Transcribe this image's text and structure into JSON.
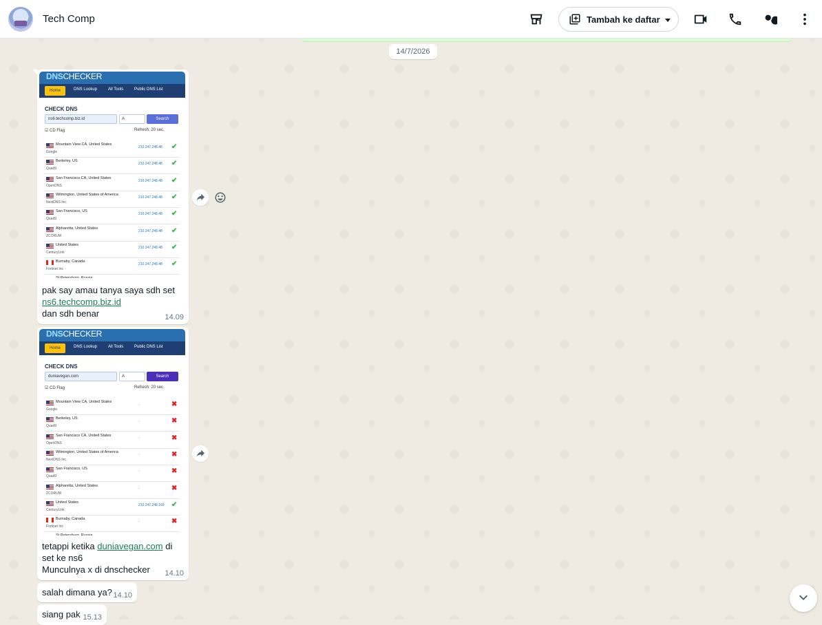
{
  "header": {
    "contact_name": "Tech Comp",
    "add_list_label": "Tambah ke daftar"
  },
  "chat": {
    "date_chip": "14/7/2026",
    "messages": [
      {
        "type": "image",
        "image": {
          "logo_main": "DNS",
          "logo_sub": "CHECKER",
          "nav": [
            "Home",
            "DNS Lookup",
            "All Tools",
            "Public DNS List"
          ],
          "title": "CHECK DNS",
          "query": "ns6.techcomp.biz.id",
          "record_type": "A",
          "search_label": "Search",
          "cd_flag": "CD Flag",
          "refresh_label": "Refresh:",
          "refresh_value": "20",
          "refresh_unit": "sec.",
          "rows": [
            {
              "flag": "us",
              "location": "Mountain View CA, United States",
              "provider": "Google",
              "ip": "210.247.248.48",
              "status": "ok"
            },
            {
              "flag": "us",
              "location": "Berkeley, US",
              "provider": "Quad9",
              "ip": "210.247.248.48",
              "status": "ok"
            },
            {
              "flag": "us",
              "location": "San Francisco CA, United States",
              "provider": "OpenDNS",
              "ip": "210.247.248.48",
              "status": "ok"
            },
            {
              "flag": "us",
              "location": "Wilmington, United States of America",
              "provider": "NextDNS Inc.",
              "ip": "210.247.248.48",
              "status": "ok"
            },
            {
              "flag": "us",
              "location": "San Francisco, US",
              "provider": "Quad9",
              "ip": "210.247.248.48",
              "status": "ok"
            },
            {
              "flag": "us",
              "location": "Alpharetta, United States",
              "provider": "ZCORUM",
              "ip": "210.247.248.48",
              "status": "ok"
            },
            {
              "flag": "us",
              "location": "United States",
              "provider": "CenturyLink",
              "ip": "210.247.248.48",
              "status": "ok"
            },
            {
              "flag": "ca",
              "location": "Burnaby, Canada",
              "provider": "Fortinet Inc",
              "ip": "210.247.248.48",
              "status": "ok"
            },
            {
              "flag": "ru",
              "location": "St Petersburg, Russia",
              "provider": "",
              "ip": "",
              "status": ""
            }
          ]
        },
        "caption_line1": "pak say amau tanya saya sdh set",
        "caption_link": "ns6.techcomp.biz.id",
        "caption_line3": "dan sdh benar",
        "time": "14.09"
      },
      {
        "type": "image",
        "image": {
          "logo_main": "DNS",
          "logo_sub": "CHECKER",
          "nav": [
            "Home",
            "DNS Lookup",
            "All Tools",
            "Public DNS List"
          ],
          "title": "CHECK DNS",
          "query": "duniavegan.com",
          "record_type": "A",
          "search_label": "Search",
          "cd_flag": "CD Flag",
          "refresh_label": "Refresh:",
          "refresh_value": "20",
          "refresh_unit": "sec.",
          "rows": [
            {
              "flag": "us",
              "location": "Mountain View CA, United States",
              "provider": "Google",
              "ip": "-",
              "status": "bad"
            },
            {
              "flag": "us",
              "location": "Berkeley, US",
              "provider": "Quad9",
              "ip": "-",
              "status": "bad"
            },
            {
              "flag": "us",
              "location": "San Francisco CA, United States",
              "provider": "OpenDNS",
              "ip": "-",
              "status": "bad"
            },
            {
              "flag": "us",
              "location": "Wilmington, United States of America",
              "provider": "NextDNS Inc.",
              "ip": "-",
              "status": "bad"
            },
            {
              "flag": "us",
              "location": "San Francisco, US",
              "provider": "Quad9",
              "ip": "-",
              "status": "bad"
            },
            {
              "flag": "us",
              "location": "Alpharetta, United States",
              "provider": "ZCORUM",
              "ip": "-",
              "status": "bad"
            },
            {
              "flag": "us",
              "location": "United States",
              "provider": "CenturyLink",
              "ip": "210.247.248.169",
              "status": "ok"
            },
            {
              "flag": "ca",
              "location": "Burnaby, Canada",
              "provider": "Fortinet Inc",
              "ip": "-",
              "status": "bad"
            },
            {
              "flag": "ru",
              "location": "St Petersburg, Russia",
              "provider": "",
              "ip": "",
              "status": ""
            }
          ]
        },
        "caption_prefix": "tetappi ketika ",
        "caption_link": "duniavegan.com",
        "caption_suffix": " di",
        "caption_line2": "set ke ns6",
        "caption_line3": "Munculnya x di dnschecker",
        "time": "14.10"
      },
      {
        "type": "text",
        "text": "salah dimana ya?",
        "time": "14.10"
      },
      {
        "type": "text",
        "text": "siang pak",
        "time": "15.13"
      }
    ]
  },
  "colors": {
    "link": "#1a7f56",
    "ok": "#3bb54a",
    "bad": "#e0242d",
    "bubble": "#ffffff",
    "chat_bg": "#efeae2"
  },
  "icons": [
    "store-icon",
    "add-to-list-icon",
    "chevron-down-icon",
    "video-call-icon",
    "phone-icon",
    "search-icon",
    "menu-icon",
    "forward-icon",
    "emoji-icon",
    "scroll-down-icon"
  ]
}
